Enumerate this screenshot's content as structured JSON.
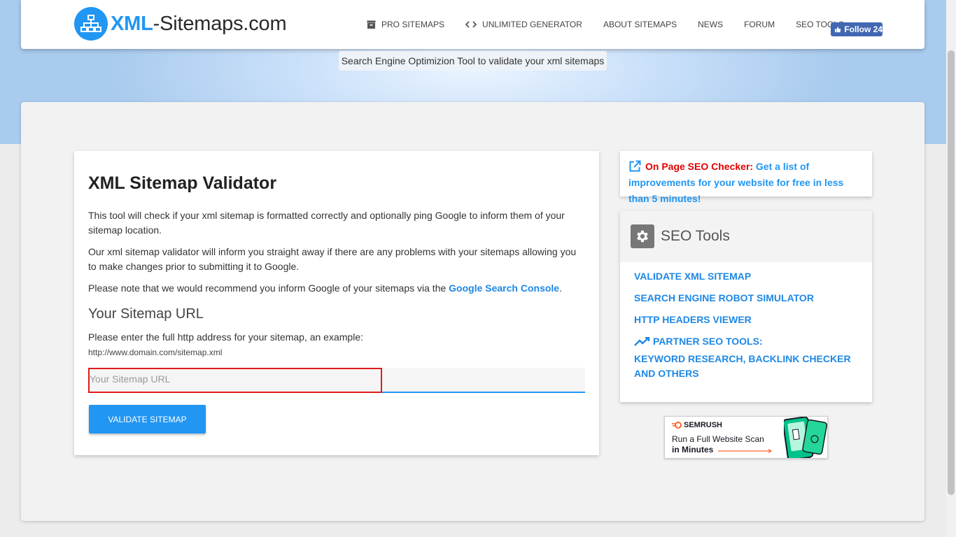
{
  "brand": {
    "name_prefix": "XML",
    "name_suffix": "-Sitemaps.com",
    "color": "#2196f3"
  },
  "nav": {
    "items": [
      {
        "label": "PRO SITEMAPS",
        "icon": "archive-icon"
      },
      {
        "label": "UNLIMITED GENERATOR",
        "icon": "code-icon"
      },
      {
        "label": "ABOUT SITEMAPS"
      },
      {
        "label": "NEWS"
      },
      {
        "label": "FORUM"
      },
      {
        "label": "SEO TOOLS"
      }
    ],
    "follow_label": "Follow 24"
  },
  "tagline": "Search Engine Optimizion Tool to validate your xml sitemaps",
  "validator": {
    "title": "XML Sitemap Validator",
    "para1": "This tool will check if your xml sitemap is formatted correctly and optionally ping Google to inform them of your sitemap location.",
    "para2": "Our xml sitemap validator will inform you straight away if there are any problems with your sitemaps allowing you to make changes prior to submitting it to Google.",
    "para3_before": "Please note that we would recommend you inform Google of your sitemaps via the ",
    "para3_link": "Google Search Console",
    "para3_after": ".",
    "subtitle": "Your Sitemap URL",
    "instructions": "Please enter the full http address for your sitemap, an example:",
    "example_url": "http://www.domain.com/sitemap.xml",
    "input_placeholder": "Your Sitemap URL",
    "input_value": "",
    "button_label": "VALIDATE SITEMAP"
  },
  "promo": {
    "label": "On Page SEO Checker:",
    "text": "Get a list of improvements for your website for free in less than 5 minutes!"
  },
  "seo_tools": {
    "title": "SEO Tools",
    "links": [
      "VALIDATE XML SITEMAP",
      "SEARCH ENGINE ROBOT SIMULATOR",
      "HTTP HEADERS VIEWER"
    ],
    "partner_label": "PARTNER SEO TOOLS:",
    "partner_text": "KEYWORD RESEARCH, BACKLINK CHECKER AND OTHERS"
  },
  "ad": {
    "brand": "SEMRUSH",
    "line1": "Run a Full Website Scan",
    "line2": "in Minutes"
  },
  "colors": {
    "accent": "#2196f3",
    "link": "#1e88e5",
    "promo_label": "#e00000",
    "facebook": "#4267b2"
  }
}
